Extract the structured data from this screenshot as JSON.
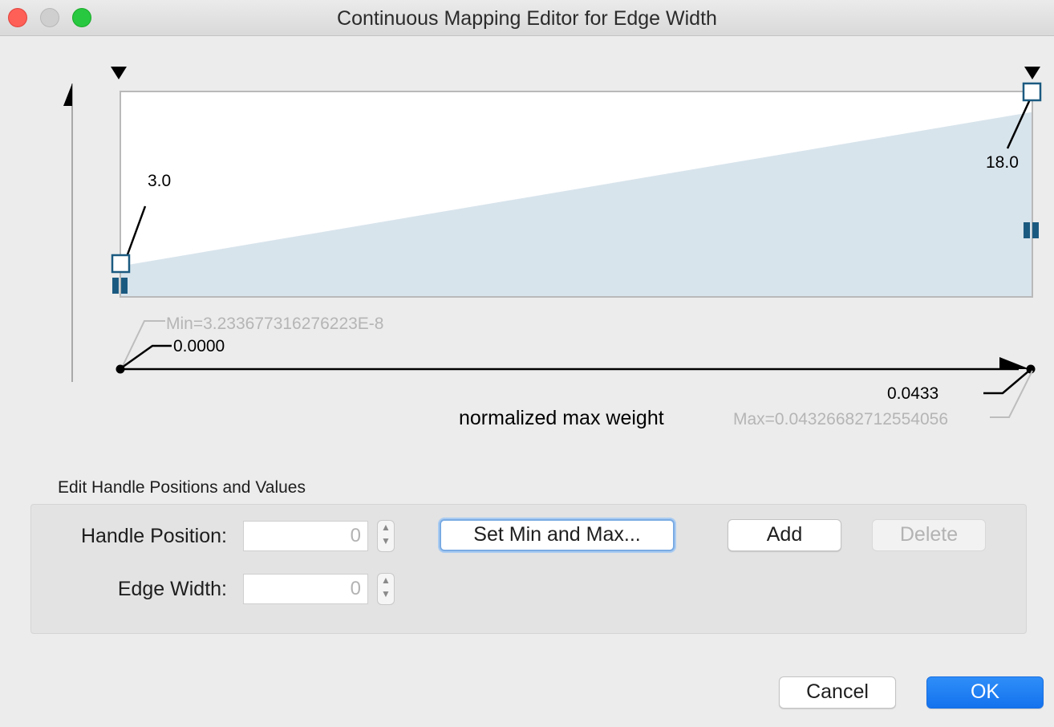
{
  "window": {
    "title": "Continuous Mapping Editor for Edge Width"
  },
  "editor": {
    "handles": [
      {
        "position_fraction": 0.0,
        "value": "3.0",
        "value_number": 3.0
      },
      {
        "position_fraction": 1.0,
        "value": "18.0",
        "value_number": 18.0
      }
    ],
    "y_range": [
      0,
      20
    ],
    "min_label": "Min=3.233677316276223E-8",
    "max_label": "Max=0.04326682712554056",
    "range_min": "0.0000",
    "range_max": "0.0433",
    "attribute_name": "normalized max weight",
    "fill_color": "#d8e4ec",
    "handle_color": "#1b5a80"
  },
  "edit_section": {
    "title": "Edit Handle Positions and Values",
    "handle_position_label": "Handle Position:",
    "handle_position_value": "0",
    "edge_width_label": "Edge Width:",
    "edge_width_value": "0",
    "set_min_max_label": "Set Min and Max...",
    "add_label": "Add",
    "delete_label": "Delete"
  },
  "footer": {
    "cancel_label": "Cancel",
    "ok_label": "OK"
  },
  "colors": {
    "accent": "#1472ee",
    "window_bg": "#ececec"
  }
}
